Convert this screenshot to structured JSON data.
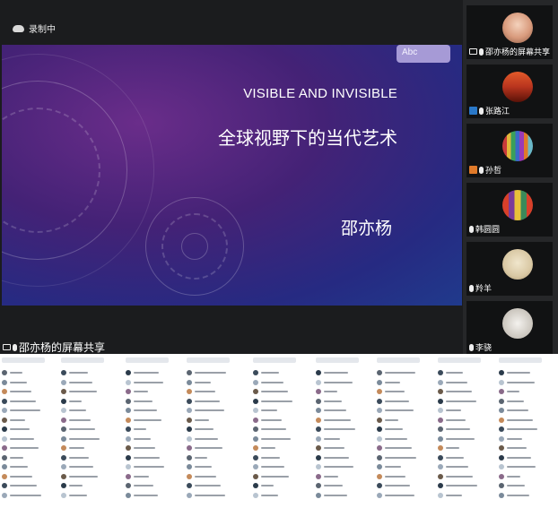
{
  "recording": {
    "label": "录制中"
  },
  "slide": {
    "abc": "Abc",
    "title_en": "VISIBLE AND INVISIBLE",
    "title_zh": "全球视野下的当代艺术",
    "author": "邵亦杨"
  },
  "main_label": "邵亦杨的屏幕共享",
  "participants": [
    {
      "name": "邵亦杨的屏幕共享",
      "icon": "screen-share-icon",
      "avatar_color": "#d89a7c"
    },
    {
      "name": "张路江",
      "icon": "user-icon",
      "avatar_color": "#b8341e",
      "icon_color": "#2a78c8"
    },
    {
      "name": "孙哲",
      "icon": "user-icon",
      "avatar_color": "#c8b25a",
      "icon_color": "#e07a2a"
    },
    {
      "name": "韩圆圆",
      "icon": "mic-icon",
      "avatar_color": "#7a3c9a"
    },
    {
      "name": "羚羊",
      "icon": "mic-icon",
      "avatar_color": "#d9c8a4"
    },
    {
      "name": "李骁",
      "icon": "mic-icon",
      "avatar_color": "#c9c4bc"
    }
  ],
  "colors": {
    "accent": "#2a78c8",
    "slide_purple": "#442276",
    "slide_blue": "#203a8c"
  }
}
